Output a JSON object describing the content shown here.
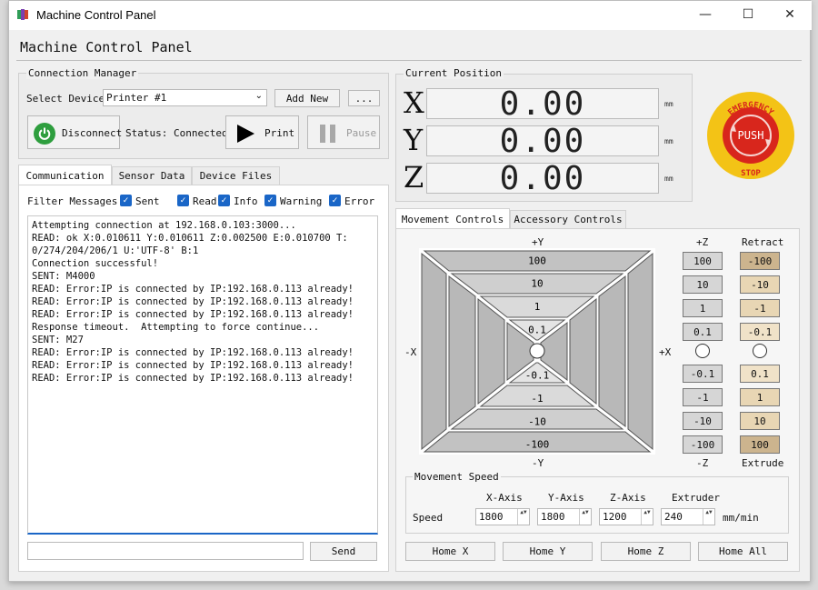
{
  "window": {
    "title": "Machine Control Panel",
    "minimize": "—",
    "maximize": "☐",
    "close": "✕"
  },
  "app_title": "Machine Control Panel",
  "connection": {
    "group_label": "Connection Manager",
    "select_label": "Select Device",
    "device_value": "Printer #1",
    "add_new": "Add New",
    "more": "...",
    "disconnect": "Disconnect",
    "status": "Status: Connected",
    "print": "Print",
    "pause": "Pause"
  },
  "tabs": {
    "communication": "Communication",
    "sensor": "Sensor Data",
    "files": "Device Files"
  },
  "filters": {
    "label": "Filter Messages:",
    "items": [
      "Sent",
      "Read",
      "Info",
      "Warning",
      "Error"
    ]
  },
  "log": {
    "lines": [
      "Attempting connection at 192.168.0.103:3000...",
      "READ: ok X:0.010611 Y:0.010611 Z:0.002500 E:0.010700 T:",
      "0/274/204/206/1 U:'UTF-8' B:1",
      "Connection successful!",
      "SENT: M4000",
      "READ: Error:IP is connected by IP:192.168.0.113 already!",
      "READ: Error:IP is connected by IP:192.168.0.113 already!",
      "READ: Error:IP is connected by IP:192.168.0.113 already!",
      "Response timeout.  Attempting to force continue...",
      "SENT: M27",
      "READ: Error:IP is connected by IP:192.168.0.113 already!",
      "READ: Error:IP is connected by IP:192.168.0.113 already!",
      "READ: Error:IP is connected by IP:192.168.0.113 already!"
    ]
  },
  "send": {
    "input_value": "",
    "button": "Send"
  },
  "position": {
    "group_label": "Current Position",
    "axes": [
      {
        "axis": "X",
        "value": "0.00",
        "unit": "mm"
      },
      {
        "axis": "Y",
        "value": "0.00",
        "unit": "mm"
      },
      {
        "axis": "Z",
        "value": "0.00",
        "unit": "mm"
      }
    ]
  },
  "estop": {
    "top": "EMERGENCY",
    "center": "PUSH",
    "bottom": "STOP"
  },
  "movement_tabs": {
    "movement": "Movement Controls",
    "accessory": "Accessory Controls"
  },
  "xy_pad": {
    "top": "+Y",
    "bottom": "-Y",
    "left": "-X",
    "right": "+X",
    "up": [
      "100",
      "10",
      "1",
      "0.1"
    ],
    "down": [
      "-0.1",
      "-1",
      "-10",
      "-100"
    ]
  },
  "z_column": {
    "top": "+Z",
    "bottom": "-Z",
    "up": [
      "100",
      "10",
      "1",
      "0.1"
    ],
    "down": [
      "-0.1",
      "-1",
      "-10",
      "-100"
    ]
  },
  "extrude_column": {
    "top": "Retract",
    "bottom": "Extrude",
    "up": [
      "-100",
      "-10",
      "-1",
      "-0.1"
    ],
    "down": [
      "0.1",
      "1",
      "10",
      "100"
    ]
  },
  "speed": {
    "group_label": "Movement Speed",
    "row_label": "Speed",
    "headers": [
      "X-Axis",
      "Y-Axis",
      "Z-Axis",
      "Extruder"
    ],
    "values": [
      "1800",
      "1800",
      "1200",
      "240"
    ],
    "unit": "mm/min"
  },
  "home": [
    "Home X",
    "Home Y",
    "Home Z",
    "Home All"
  ],
  "colors": {
    "accent_blue": "#1a66c7",
    "disconnect_green": "#2e9e3e",
    "estop_red": "#d8261c",
    "estop_yellow": "#f3c316"
  }
}
